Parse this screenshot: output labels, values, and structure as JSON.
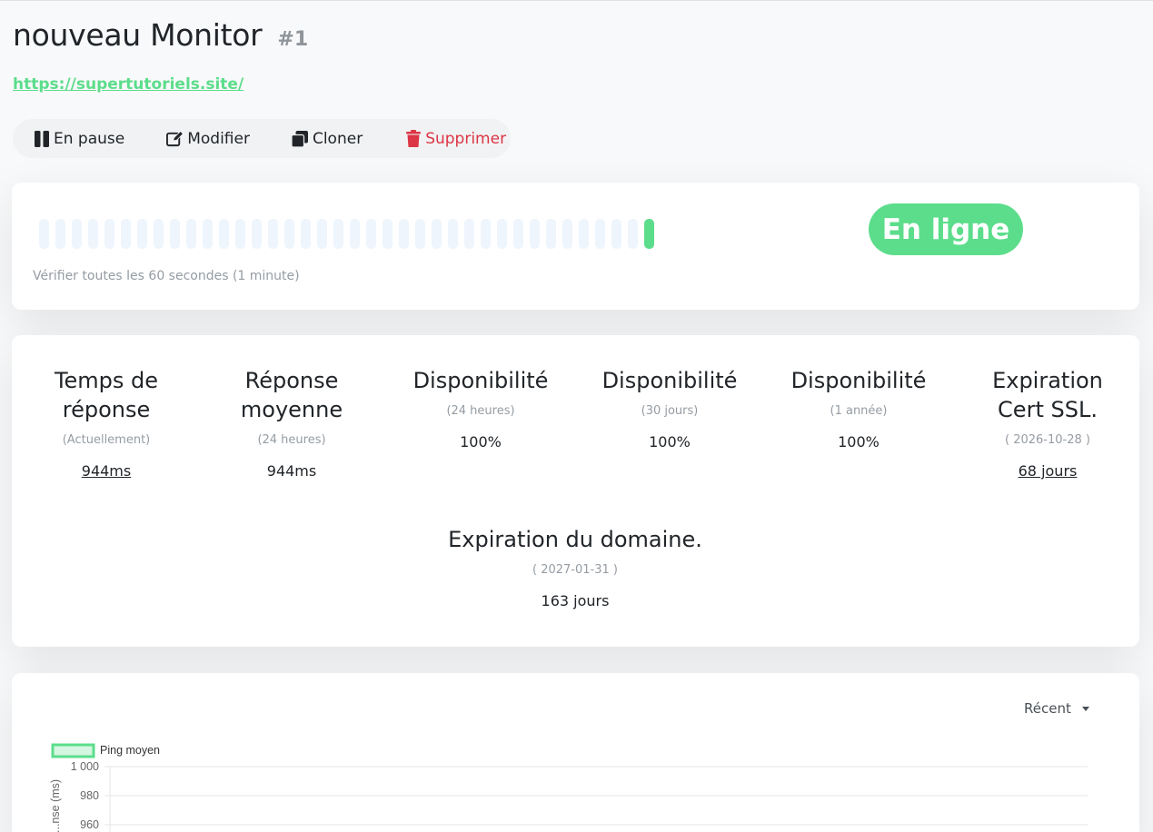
{
  "monitor": {
    "name": "nouveau Monitor",
    "id": "#1",
    "url": "https://supertutoriels.site/"
  },
  "toolbar": {
    "pause_label": "En pause",
    "edit_label": "Modifier",
    "clone_label": "Cloner",
    "delete_label": "Supprimer"
  },
  "heartbeat": {
    "beats": [
      "empty",
      "empty",
      "empty",
      "empty",
      "empty",
      "empty",
      "empty",
      "empty",
      "empty",
      "empty",
      "empty",
      "empty",
      "empty",
      "empty",
      "empty",
      "empty",
      "empty",
      "empty",
      "empty",
      "empty",
      "empty",
      "empty",
      "empty",
      "empty",
      "empty",
      "empty",
      "empty",
      "empty",
      "empty",
      "empty",
      "empty",
      "empty",
      "empty",
      "empty",
      "empty",
      "empty",
      "empty",
      "up"
    ],
    "interval_text": "Vérifier toutes les 60 secondes (1 minute)",
    "status": "En ligne"
  },
  "stats": {
    "response": {
      "title": "Temps de réponse",
      "sub": "(Actuellement)",
      "value": "944ms"
    },
    "avg_response": {
      "title": "Réponse moyenne",
      "sub": "(24 heures)",
      "value": "944ms"
    },
    "uptime_24h": {
      "title": "Disponibilité",
      "sub": "(24 heures)",
      "value": "100%"
    },
    "uptime_30d": {
      "title": "Disponibilité",
      "sub": "(30 jours)",
      "value": "100%"
    },
    "uptime_1y": {
      "title": "Disponibilité",
      "sub": "(1 année)",
      "value": "100%"
    },
    "ssl": {
      "title": "Expiration Cert SSL.",
      "sub": "( 2026-10-28 )",
      "value": "68 jours"
    },
    "domain": {
      "title": "Expiration du domaine.",
      "sub": "( 2027-01-31 )",
      "value": "163 jours"
    }
  },
  "chart": {
    "range_label": "Récent"
  },
  "chart_data": {
    "type": "line",
    "series": [
      {
        "name": "Ping moyen",
        "values": []
      }
    ],
    "ylabel": "...nse (ms)",
    "yticks": [
      "1 000",
      "980",
      "960"
    ],
    "ylim": [
      940,
      1000
    ],
    "grid": true,
    "legend": "top-left"
  },
  "colors": {
    "accent": "#5cdd8b",
    "danger": "#dc3545",
    "empty_beat": "#eef5fd",
    "muted": "#959ca3"
  }
}
